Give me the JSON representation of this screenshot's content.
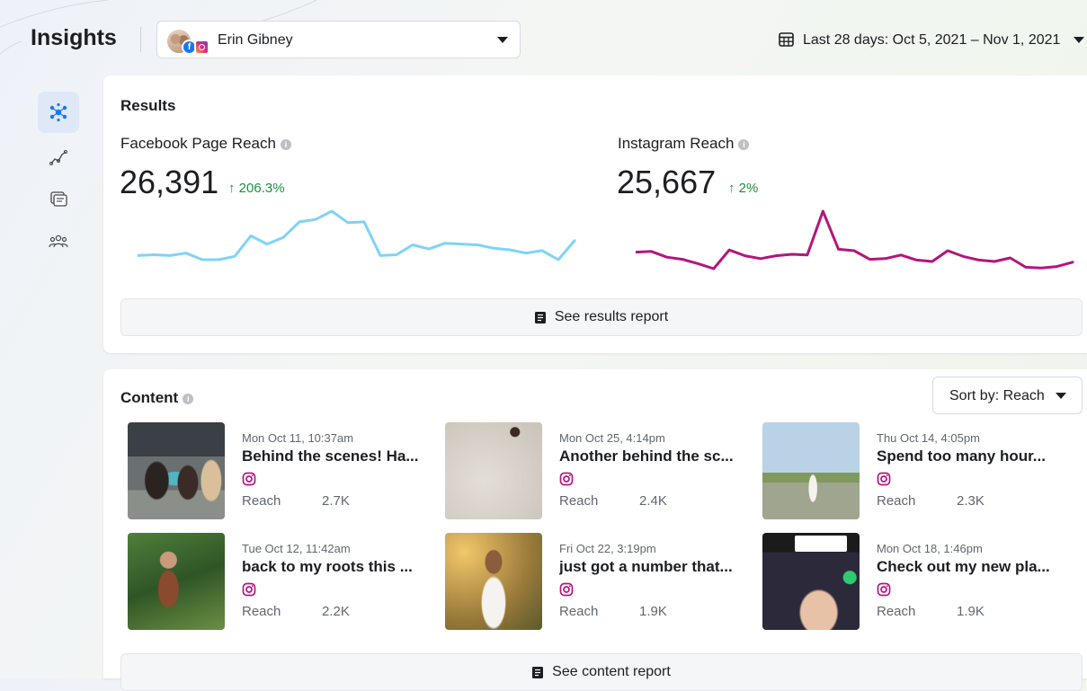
{
  "header": {
    "title": "Insights",
    "account_name": "Erin Gibney",
    "date_range": "Last 28 days: Oct 5, 2021 – Nov 1, 2021"
  },
  "side_nav": [
    {
      "icon": "overview-icon",
      "active": true
    },
    {
      "icon": "trends-icon",
      "active": false
    },
    {
      "icon": "content-icon",
      "active": false
    },
    {
      "icon": "audience-icon",
      "active": false
    }
  ],
  "results": {
    "title": "Results",
    "facebook": {
      "label": "Facebook Page Reach",
      "value": "26,391",
      "change": "↑ 206.3%"
    },
    "instagram": {
      "label": "Instagram Reach",
      "value": "25,667",
      "change": "↑ 2%"
    },
    "report_button": "See results report"
  },
  "chart_data": [
    {
      "type": "line",
      "series": [
        {
          "values": [
            44,
            45,
            44,
            47,
            39,
            39,
            43,
            68,
            58,
            66,
            85,
            88,
            98,
            84,
            85,
            44,
            45,
            57,
            52,
            59,
            58,
            57,
            53,
            51,
            47,
            50,
            39,
            62
          ]
        }
      ],
      "color": "#7fd3f7"
    },
    {
      "type": "line",
      "series": [
        {
          "values": [
            43,
            44,
            36,
            33,
            27,
            20,
            46,
            38,
            34,
            38,
            40,
            39,
            100,
            47,
            45,
            33,
            34,
            39,
            32,
            30,
            45,
            37,
            32,
            30,
            35,
            22,
            21,
            23,
            29
          ]
        }
      ],
      "color": "#b4157d"
    }
  ],
  "content": {
    "title": "Content",
    "sort_label": "Sort by: Reach",
    "report_button": "See content report",
    "posts": [
      {
        "date": "Mon Oct 11, 10:37am",
        "caption": "Behind the scenes! Ha...",
        "metric_label": "Reach",
        "metric_value": "2.7K"
      },
      {
        "date": "Mon Oct 25, 4:14pm",
        "caption": "Another behind the sc...",
        "metric_label": "Reach",
        "metric_value": "2.4K"
      },
      {
        "date": "Thu Oct 14, 4:05pm",
        "caption": "Spend too many hour...",
        "metric_label": "Reach",
        "metric_value": "2.3K"
      },
      {
        "date": "Tue Oct 12, 11:42am",
        "caption": "back to my roots this ...",
        "metric_label": "Reach",
        "metric_value": "2.2K"
      },
      {
        "date": "Fri Oct 22, 3:19pm",
        "caption": "just got a number that...",
        "metric_label": "Reach",
        "metric_value": "1.9K"
      },
      {
        "date": "Mon Oct 18, 1:46pm",
        "caption": "Check out my new pla...",
        "metric_label": "Reach",
        "metric_value": "1.9K"
      }
    ]
  },
  "colors": {
    "facebook_line": "#7fd3f7",
    "instagram_line": "#b4157d",
    "positive_change": "#1e8e3e",
    "active_nav": "#dfe8f6"
  }
}
